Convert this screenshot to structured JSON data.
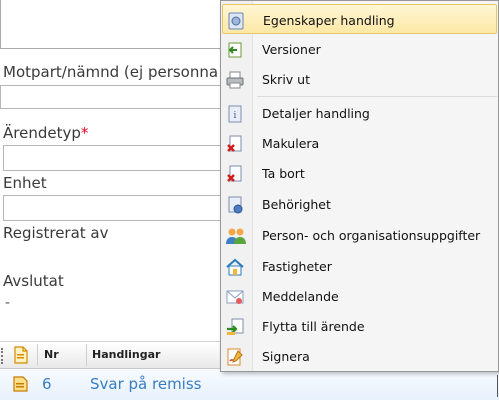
{
  "form": {
    "counterparty_label": "Motpart/nämnd (ej personna",
    "casetype_label": "Ärendetyp",
    "casetype_required": "*",
    "unit_label": "Enhet",
    "registered_by_label": "Registrerat av",
    "closed_label": "Avslutat",
    "closed_value": "-"
  },
  "grid": {
    "columns": [
      "Nr",
      "Handlingar"
    ],
    "rows": [
      {
        "nr": "6",
        "title": "Svar på remiss"
      }
    ]
  },
  "context_menu": {
    "highlighted_index": 0,
    "items": [
      {
        "label": "Egenskaper handling",
        "icon": "properties-icon"
      },
      {
        "label": "Versioner",
        "icon": "versions-icon"
      },
      {
        "label": "Skriv ut",
        "icon": "printer-icon"
      },
      {
        "label": "Detaljer handling",
        "icon": "details-icon"
      },
      {
        "label": "Makulera",
        "icon": "void-document-icon"
      },
      {
        "label": "Ta bort",
        "icon": "delete-document-icon"
      },
      {
        "label": "Behörighet",
        "icon": "permissions-icon"
      },
      {
        "label": "Person- och organisationsuppgifter",
        "icon": "people-icon"
      },
      {
        "label": "Fastigheter",
        "icon": "property-house-icon"
      },
      {
        "label": "Meddelande",
        "icon": "message-icon"
      },
      {
        "label": "Flytta till ärende",
        "icon": "move-to-case-icon"
      },
      {
        "label": "Signera",
        "icon": "sign-icon"
      }
    ]
  },
  "colors": {
    "link_blue": "#3a7cc2",
    "highlight": "#fde8a5",
    "required_red": "#e0001b"
  }
}
